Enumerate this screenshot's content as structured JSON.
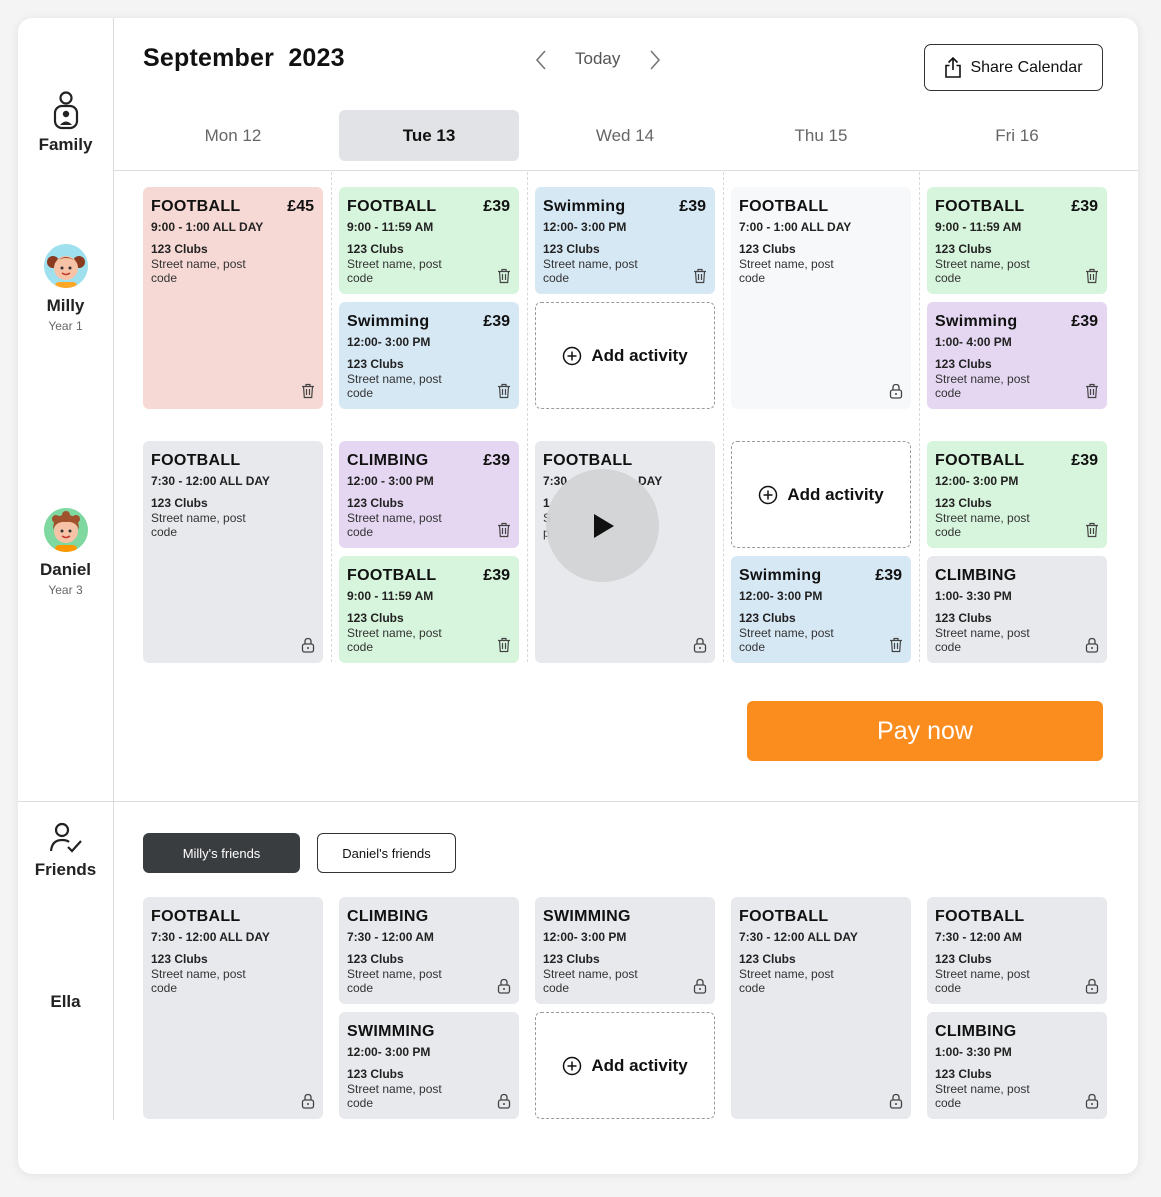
{
  "header": {
    "month": "September",
    "year": "2023",
    "today_label": "Today",
    "share_label": "Share Calendar"
  },
  "days": [
    "Mon 12",
    "Tue 13",
    "Wed 14",
    "Thu 15",
    "Fri 16"
  ],
  "sidebar": {
    "family_label": "Family",
    "friends_label": "Friends",
    "children": [
      {
        "name": "Milly",
        "year": "Year 1"
      },
      {
        "name": "Daniel",
        "year": "Year 3"
      }
    ],
    "friend": {
      "name": "Ella"
    }
  },
  "milly": {
    "mon": {
      "title": "FOOTBALL",
      "price": "£45",
      "time": "9:00 - 1:00 ALL DAY",
      "club": "123 Clubs",
      "addr": "Street name, post code"
    },
    "tue1": {
      "title": "FOOTBALL",
      "price": "£39",
      "time": "9:00 - 11:59 AM",
      "club": "123 Clubs",
      "addr": "Street name, post code"
    },
    "tue2": {
      "title": "Swimming",
      "price": "£39",
      "time": "12:00- 3:00 PM",
      "club": "123 Clubs",
      "addr": "Street name, post code"
    },
    "wed1": {
      "title": "Swimming",
      "price": "£39",
      "time": "12:00- 3:00 PM",
      "club": "123 Clubs",
      "addr": "Street name, post code"
    },
    "thu": {
      "title": "FOOTBALL",
      "time": "7:00 - 1:00 ALL DAY",
      "club": "123 Clubs",
      "addr": "Street name, post code"
    },
    "fri1": {
      "title": "FOOTBALL",
      "price": "£39",
      "time": "9:00 - 11:59 AM",
      "club": "123 Clubs",
      "addr": "Street name, post code"
    },
    "fri2": {
      "title": "Swimming",
      "price": "£39",
      "time": "1:00- 4:00 PM",
      "club": "123 Clubs",
      "addr": "Street name, post code"
    }
  },
  "daniel": {
    "mon": {
      "title": "FOOTBALL",
      "time": "7:30 - 12:00 ALL DAY",
      "club": "123 Clubs",
      "addr": "Street name, post code"
    },
    "tue1": {
      "title": "CLIMBING",
      "price": "£39",
      "time": "12:00 - 3:00 PM",
      "club": "123 Clubs",
      "addr": "Street name, post code"
    },
    "tue2": {
      "title": "FOOTBALL",
      "price": "£39",
      "time": "9:00 - 11:59 AM",
      "club": "123 Clubs",
      "addr": "Street name, post code"
    },
    "wed": {
      "title": "FOOTBALL",
      "time_a": "7:30",
      "time_b": "DAY",
      "club": "1",
      "addr": "S",
      "addr2": "p"
    },
    "thu2": {
      "title": "Swimming",
      "price": "£39",
      "time": "12:00- 3:00 PM",
      "club": "123 Clubs",
      "addr": "Street name, post code"
    },
    "fri1": {
      "title": "FOOTBALL",
      "price": "£39",
      "time": "12:00- 3:00 PM",
      "club": "123 Clubs",
      "addr": "Street name, post code"
    },
    "fri2": {
      "title": "CLIMBING",
      "time": "1:00- 3:30 PM",
      "club": "123 Clubs",
      "addr": "Street name, post code"
    }
  },
  "add_activity_label": "Add activity",
  "pay_label": "Pay now",
  "friend_tabs": [
    "Milly's friends",
    "Daniel's friends"
  ],
  "ella": {
    "mon": {
      "title": "FOOTBALL",
      "time": "7:30 - 12:00 ALL DAY",
      "club": "123 Clubs",
      "addr": "Street name, post code"
    },
    "tue1": {
      "title": "CLIMBING",
      "time": "7:30 - 12:00 AM",
      "club": "123 Clubs",
      "addr": "Street name, post code"
    },
    "tue2": {
      "title": "SWIMMING",
      "time": "12:00- 3:00 PM",
      "club": "123 Clubs",
      "addr": "Street name, post code"
    },
    "wed1": {
      "title": "SWIMMING",
      "time": "12:00- 3:00 PM",
      "club": "123 Clubs",
      "addr": "Street name, post code"
    },
    "thu": {
      "title": "FOOTBALL",
      "time": "7:30 - 12:00 ALL DAY",
      "club": "123 Clubs",
      "addr": "Street name, post code"
    },
    "fri1": {
      "title": "FOOTBALL",
      "time": "7:30 - 12:00 AM",
      "club": "123 Clubs",
      "addr": "Street name, post code"
    },
    "fri2": {
      "title": "CLIMBING",
      "time": "1:00- 3:30 PM",
      "club": "123 Clubs",
      "addr": "Street name, post code"
    }
  }
}
